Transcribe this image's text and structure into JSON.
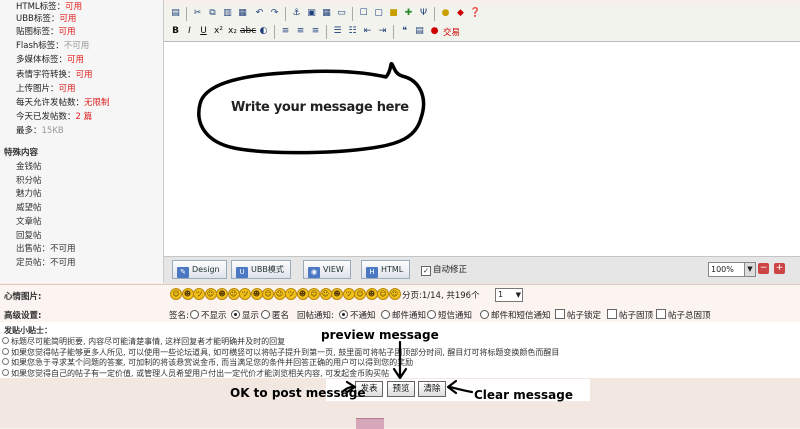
{
  "info": {
    "rows": [
      {
        "label": "HTML标签：",
        "value": "可用",
        "muted": false
      },
      {
        "label": "UBB标签：",
        "value": "可用",
        "muted": false
      },
      {
        "label": "贴图标签：",
        "value": "可用",
        "muted": false
      },
      {
        "label": "Flash标签：",
        "value": "不可用",
        "muted": true
      },
      {
        "label": "多媒体标签：",
        "value": "可用",
        "muted": false
      },
      {
        "label": "表情字符转换：",
        "value": "可用",
        "muted": false
      },
      {
        "label": "上传图片：",
        "value": "可用",
        "muted": false
      },
      {
        "label": "每天允许发帖数：",
        "value": "无限制",
        "muted": false
      },
      {
        "label": "今天已发帖数：",
        "value": "2 篇",
        "muted": false
      },
      {
        "label": "最多：",
        "value": "15KB",
        "muted": true
      }
    ],
    "special_header": "特殊内容",
    "special_items": [
      "金钱帖",
      "积分帖",
      "魅力帖",
      "威望帖",
      "文章帖",
      "回复帖",
      "出售帖：不可用",
      "定员帖：不可用"
    ]
  },
  "editor": {
    "body_text": "Write your message here",
    "modes": [
      "Design",
      "UBB模式",
      "VIEW",
      "HTML"
    ],
    "autofix_label": "自动修正",
    "autofix_checked": true,
    "zoom": "100%",
    "zoom_in": "+",
    "zoom_out": "−",
    "toolbar_extra_label": "交易"
  },
  "mood": {
    "label": "心情图片:",
    "pager_text": "分页:1/14, 共196个",
    "page_value": "1",
    "count": 20
  },
  "advanced": {
    "label": "高级设置:",
    "sign_label": "签名:",
    "sign_options": [
      "不显示",
      "显示",
      "匿名"
    ],
    "sign_selected": 1,
    "notify_label": "回帖通知:",
    "notify_options": [
      "不通知",
      "邮件通知",
      "短信通知",
      "邮件和短信通知"
    ],
    "notify_selected": 0,
    "checkboxes": [
      "帖子锁定",
      "帖子固顶",
      "帖子总固顶"
    ]
  },
  "tips": {
    "header": "发贴小贴士：",
    "lines": [
      "标题尽可能简明扼要, 内容尽可能清楚事情, 这样回复者才能明确并及时的回复",
      "如果您觉得帖子能够更多人所见, 可以使用一些论坛道具, 如可横竖可以将帖子提升到第一页, 鼓里面可将帖子固顶部分时间, 醒目灯可将标题变换颜色而醒目",
      "如果您急于寻求某个问题的答案, 可加制的将该悬赏说金币, 而当满足您的条件并回答正确的用户可以得到您的奖励",
      "如果您觉得自己的帖子有一定价值, 或管理人员希望用户付出一定代价才能浏览相关内容, 可发起金币购买帖"
    ]
  },
  "buttons": {
    "post": "发表",
    "preview": "预览",
    "clear": "清除"
  },
  "annotations": {
    "preview": "preview message",
    "ok": "OK to post message",
    "clear": "Clear message"
  }
}
